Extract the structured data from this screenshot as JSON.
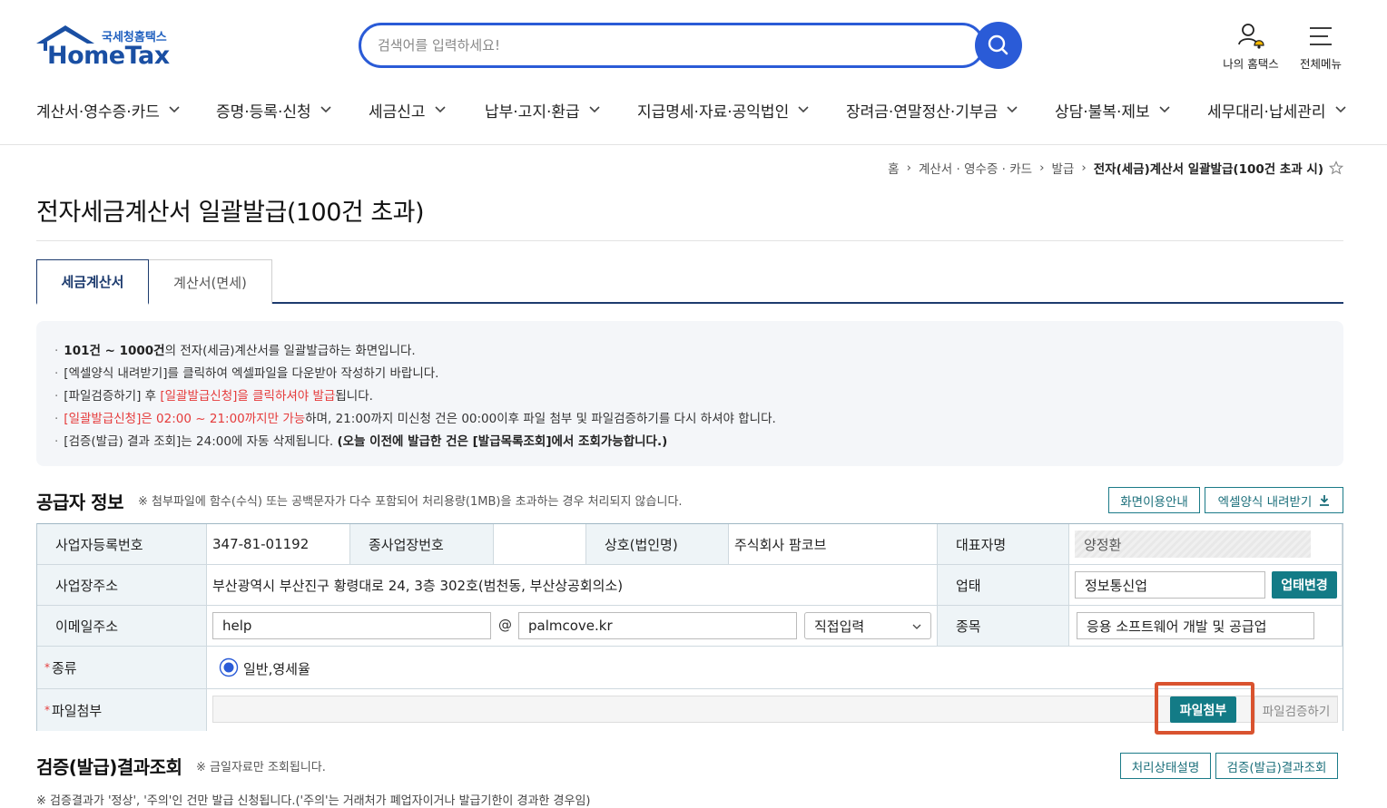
{
  "header": {
    "logo_kr": "국세청홈택스",
    "logo_en": "HomeTax",
    "search_placeholder": "검색어를 입력하세요!",
    "util": [
      {
        "label": "나의 홈택스",
        "icon": "user-bell-icon"
      },
      {
        "label": "전체메뉴",
        "icon": "hamburger-menu-icon"
      }
    ],
    "gnb": [
      "계산서·영수증·카드",
      "증명·등록·신청",
      "세금신고",
      "납부·고지·환급",
      "지급명세·자료·공익법인",
      "장려금·연말정산·기부금",
      "상담·불복·제보",
      "세무대리·납세관리"
    ]
  },
  "breadcrumb": {
    "items": [
      "홈",
      "계산서 · 영수증 · 카드",
      "발급"
    ],
    "current": "전자(세금)계산서 일괄발급(100건 초과 시)"
  },
  "page_title": "전자세금계산서 일괄발급(100건 초과)",
  "tabs": [
    {
      "label": "세금계산서",
      "active": true
    },
    {
      "label": "계산서(면세)",
      "active": false
    }
  ],
  "info": {
    "line1_bold": "101건 ~ 1000건",
    "line1_rest": "의 전자(세금)계산서를 일괄발급하는 화면입니다.",
    "line2": "[엑셀양식 내려받기]를 클릭하여 엑셀파일을 다운받아 작성하기 바랍니다.",
    "line3_a": "[파일검증하기] 후 ",
    "line3_red": "[일괄발급신청]을 클릭하셔야 발급",
    "line3_b": "됩니다.",
    "line4_red": "[일괄발급신청]은 02:00 ~ 21:00까지만 가능",
    "line4_rest": "하며, 21:00까지 미신청 건은 00:00이후 파일 첨부 및 파일검증하기를 다시 하셔야 합니다.",
    "line5_a": "[검증(발급) 결과 조회]는 24:00에 자동 삭제됩니다. ",
    "line5_bold": "(오늘 이전에 발급한 건은 [발급목록조회]에서 조회가능합니다.)"
  },
  "supplier": {
    "title": "공급자 정보",
    "note": "※ 첨부파일에 함수(수식) 또는 공백문자가 다수 포함되어 처리용량(1MB)을 초과하는 경우 처리되지 않습니다.",
    "guide_button": "화면이용안내",
    "excel_button": "엑셀양식 내려받기",
    "labels": {
      "biz_no": "사업자등록번호",
      "sub_biz_no": "종사업장번호",
      "company": "상호(법인명)",
      "ceo": "대표자명",
      "address": "사업장주소",
      "biz_type": "업태",
      "email": "이메일주소",
      "biz_item": "종목",
      "kind": "종류",
      "attach": "파일첨부"
    },
    "values": {
      "biz_no": "347-81-01192",
      "sub_biz_no": "",
      "company": "주식회사 팜코브",
      "ceo": "양정환",
      "address": "부산광역시 부산진구 황령대로 24, 3층 302호(범천동, 부산상공회의소)",
      "biz_type": "정보통신업",
      "email_id": "help",
      "email_at": "@",
      "email_domain": "palmcove.kr",
      "email_select": "직접입력",
      "biz_item": "응용 소프트웨어 개발 및 공급업",
      "kind_option": "일반,영세율"
    },
    "change_type_button": "업태변경",
    "attach_button": "파일첨부",
    "verify_button": "파일검증하기",
    "required_mark": "*"
  },
  "verify": {
    "title": "검증(발급)결과조회",
    "note": "※ 금일자료만 조회됩니다.",
    "status_button": "처리상태설명",
    "result_button": "검증(발급)결과조회",
    "bottom_note": "※ 검증결과가 '정상', '주의'인 건만 발급 신청됩니다.('주의'는 거래처가 폐업자이거나 발급기한이 경과한 경우임)"
  },
  "colors": {
    "brand_blue": "#2a5bd7",
    "teal": "#137b86",
    "highlight": "#d9532f",
    "red_text": "#e53b3b"
  }
}
